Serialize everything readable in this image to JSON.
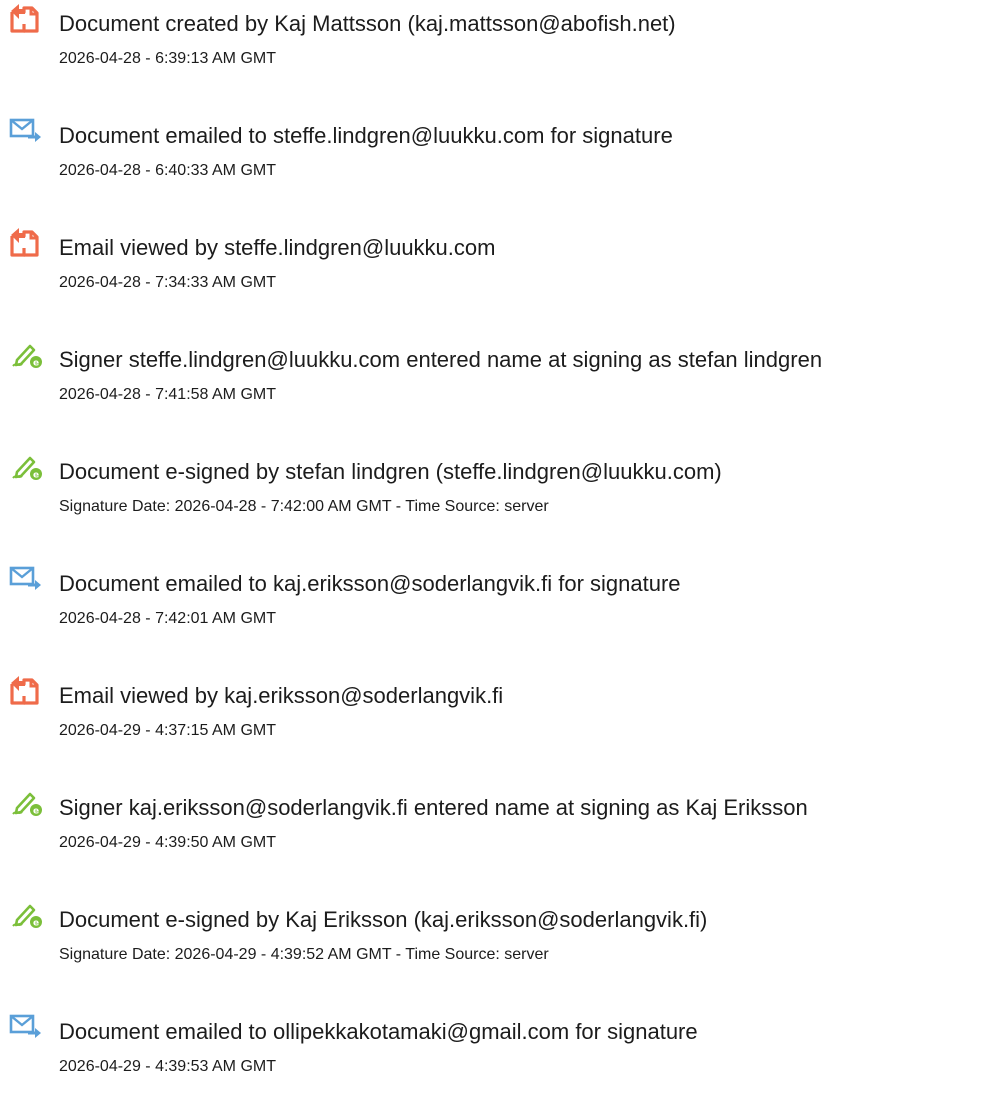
{
  "audit_trail": {
    "events": [
      {
        "icon": "document-created-icon",
        "title": "Document created by Kaj Mattsson (kaj.mattsson@abofish.net)",
        "time": "2026-04-28 - 6:39:13 AM GMT"
      },
      {
        "icon": "document-emailed-icon",
        "title": "Document emailed to steffe.lindgren@luukku.com for signature",
        "time": "2026-04-28 - 6:40:33 AM GMT"
      },
      {
        "icon": "document-viewed-icon",
        "title": "Email viewed by steffe.lindgren@luukku.com",
        "time": "2026-04-28 - 7:34:33 AM GMT"
      },
      {
        "icon": "esign-pen-icon",
        "title": "Signer steffe.lindgren@luukku.com entered name at signing as stefan lindgren",
        "time": "2026-04-28 - 7:41:58 AM GMT"
      },
      {
        "icon": "esign-pen-icon",
        "title": "Document e-signed by stefan lindgren (steffe.lindgren@luukku.com)",
        "time": "Signature Date: 2026-04-28 - 7:42:00 AM GMT - Time Source: server"
      },
      {
        "icon": "document-emailed-icon",
        "title": "Document emailed to kaj.eriksson@soderlangvik.fi for signature",
        "time": "2026-04-28 - 7:42:01 AM GMT"
      },
      {
        "icon": "document-viewed-icon",
        "title": "Email viewed by kaj.eriksson@soderlangvik.fi",
        "time": "2026-04-29 - 4:37:15 AM GMT"
      },
      {
        "icon": "esign-pen-icon",
        "title": "Signer kaj.eriksson@soderlangvik.fi entered name at signing as Kaj Eriksson",
        "time": "2026-04-29 - 4:39:50 AM GMT"
      },
      {
        "icon": "esign-pen-icon",
        "title": "Document e-signed by Kaj Eriksson (kaj.eriksson@soderlangvik.fi)",
        "time": "Signature Date: 2026-04-29 - 4:39:52 AM GMT - Time Source: server"
      },
      {
        "icon": "document-emailed-icon",
        "title": "Document emailed to ollipekkakotamaki@gmail.com for signature",
        "time": "2026-04-29 - 4:39:53 AM GMT"
      }
    ]
  },
  "colors": {
    "document_icon": "#ef6b4a",
    "email_icon": "#5a9fd8",
    "pen_icon": "#7bbf3a",
    "text": "#1c1c1c"
  }
}
